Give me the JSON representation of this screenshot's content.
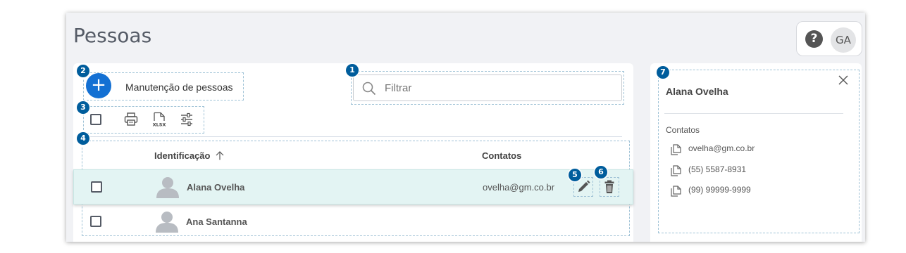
{
  "page": {
    "title": "Pessoas"
  },
  "header": {
    "help_label": "?",
    "avatar_initials": "GA"
  },
  "toolbar": {
    "add_label": "Manutenção de pessoas",
    "filter_placeholder": "Filtrar",
    "icons": [
      "printer-icon",
      "xlsx-export-icon",
      "filter-settings-icon"
    ]
  },
  "table": {
    "columns": [
      {
        "label": "Identificação",
        "sort": "ascending"
      },
      {
        "label": "Contatos"
      }
    ],
    "rows": [
      {
        "name": "Alana Ovelha",
        "contact": "ovelha@gm.co.br",
        "selected": true
      },
      {
        "name": "Ana Santanna",
        "contact": "",
        "selected": false
      }
    ]
  },
  "detail": {
    "name": "Alana Ovelha",
    "contacts_label": "Contatos",
    "contacts": [
      "ovelha@gm.co.br",
      "(55) 5587-8931",
      "(99) 99999-9999"
    ]
  },
  "callouts": [
    "1",
    "2",
    "3",
    "4",
    "5",
    "6",
    "7"
  ],
  "colors": {
    "accent": "#1370d3",
    "badge": "#005d9c",
    "selected_row": "#e3f4f3"
  }
}
